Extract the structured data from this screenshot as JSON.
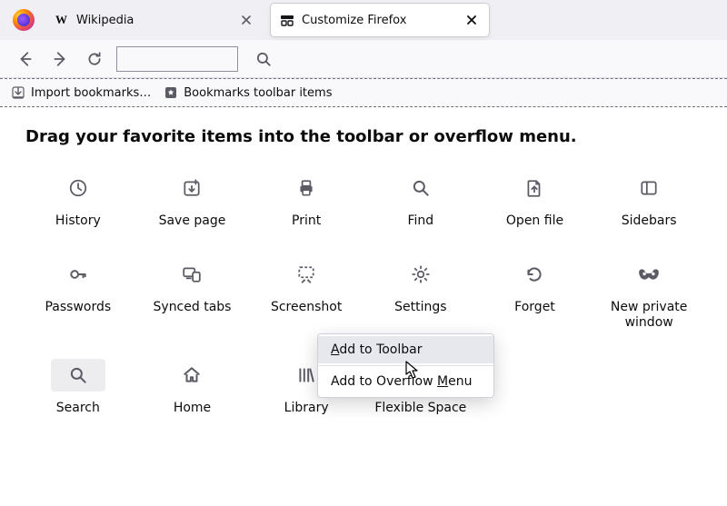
{
  "tabs": [
    {
      "label": "Wikipedia",
      "icon": "wikipedia-icon",
      "active": false
    },
    {
      "label": "Customize Firefox",
      "icon": "customize-icon",
      "active": true
    }
  ],
  "bookmarks_bar": {
    "import_label": "Import bookmarks…",
    "items_label": "Bookmarks toolbar items"
  },
  "heading": "Drag your favorite items into the toolbar or overflow menu.",
  "tiles": {
    "history": "History",
    "save_page": "Save page",
    "print": "Print",
    "find": "Find",
    "open_file": "Open file",
    "sidebars": "Sidebars",
    "passwords": "Passwords",
    "synced_tabs": "Synced tabs",
    "screenshot": "Screenshot",
    "settings": "Settings",
    "forget": "Forget",
    "new_private_window": "New private\nwindow",
    "search": "Search",
    "home": "Home",
    "library": "Library",
    "flexible_space": "Flexible Space"
  },
  "context_menu": {
    "add_toolbar_pre": "",
    "add_toolbar_u": "A",
    "add_toolbar_post": "dd to Toolbar",
    "add_overflow_pre": "Add to Overflow ",
    "add_overflow_u": "M",
    "add_overflow_post": "enu"
  }
}
